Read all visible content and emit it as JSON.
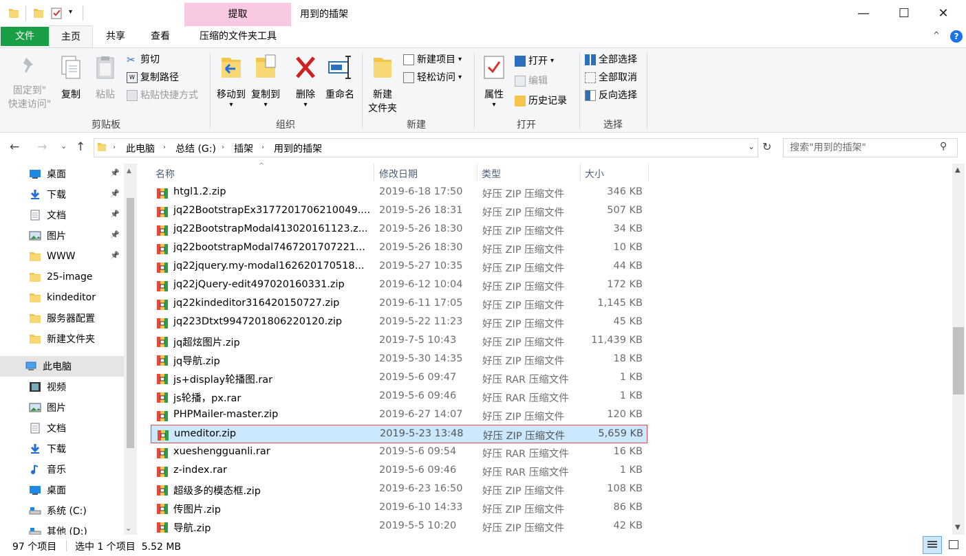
{
  "title_bar": {
    "context_tab": "提取",
    "window_title": "用到的插架",
    "minimize": "—",
    "maximize": "☐",
    "close": "✕"
  },
  "tabs": {
    "file": "文件",
    "home": "主页",
    "share": "共享",
    "view": "查看",
    "compressed_tools": "压缩的文件夹工具"
  },
  "ribbon": {
    "clipboard": {
      "pin": "固定到\"快速访问\"",
      "pin_line1": "固定到\"",
      "pin_line2": "快速访问\"",
      "copy": "复制",
      "paste": "粘贴",
      "cut": "剪切",
      "copy_path": "复制路径",
      "paste_shortcut": "粘贴快捷方式",
      "group": "剪贴板"
    },
    "organize": {
      "move_to": "移动到",
      "copy_to": "复制到",
      "delete": "删除",
      "rename": "重命名",
      "group": "组织"
    },
    "new": {
      "new_folder_line1": "新建",
      "new_folder_line2": "文件夹",
      "new_item": "新建项目",
      "easy_access": "轻松访问",
      "group": "新建"
    },
    "open": {
      "properties": "属性",
      "open": "打开",
      "edit": "编辑",
      "history": "历史记录",
      "group": "打开"
    },
    "select": {
      "select_all": "全部选择",
      "select_none": "全部取消",
      "invert": "反向选择",
      "group": "选择"
    }
  },
  "address": {
    "crumbs": [
      "此电脑",
      "总结 (G:)",
      "插架",
      "用到的插架"
    ],
    "search_placeholder": "搜索\"用到的插架\""
  },
  "nav": {
    "items": [
      {
        "label": "桌面",
        "icon": "desktop-icon",
        "pinned": true
      },
      {
        "label": "下载",
        "icon": "download-icon",
        "pinned": true
      },
      {
        "label": "文档",
        "icon": "document-icon",
        "pinned": true
      },
      {
        "label": "图片",
        "icon": "picture-icon",
        "pinned": true
      },
      {
        "label": "WWW",
        "icon": "folder-icon",
        "pinned": true
      },
      {
        "label": "25-image",
        "icon": "folder-icon",
        "pinned": false
      },
      {
        "label": "kindeditor",
        "icon": "folder-icon",
        "pinned": false
      },
      {
        "label": "服务器配置",
        "icon": "folder-icon",
        "pinned": false
      },
      {
        "label": "新建文件夹",
        "icon": "folder-icon",
        "pinned": false
      },
      {
        "label": "此电脑",
        "icon": "computer-icon",
        "pinned": false
      },
      {
        "label": "视频",
        "icon": "video-icon",
        "pinned": false
      },
      {
        "label": "图片",
        "icon": "picture-icon",
        "pinned": false
      },
      {
        "label": "文档",
        "icon": "document-icon",
        "pinned": false
      },
      {
        "label": "下载",
        "icon": "download-icon",
        "pinned": false
      },
      {
        "label": "音乐",
        "icon": "music-icon",
        "pinned": false
      },
      {
        "label": "桌面",
        "icon": "desktop-icon",
        "pinned": false
      },
      {
        "label": "系统 (C:)",
        "icon": "drive-icon",
        "pinned": false
      },
      {
        "label": "其他 (D:)",
        "icon": "drive-icon",
        "pinned": false
      }
    ]
  },
  "list": {
    "headers": {
      "name": "名称",
      "date": "修改日期",
      "type": "类型",
      "size": "大小"
    },
    "rows": [
      {
        "name": "htgl1.2.zip",
        "date": "2019-6-18 17:50",
        "type": "好压 ZIP 压缩文件",
        "size": "346 KB"
      },
      {
        "name": "jq22BootstrapEx3177201706210049....",
        "date": "2019-5-26 18:31",
        "type": "好压 ZIP 压缩文件",
        "size": "507 KB"
      },
      {
        "name": "jq22BootstrapModal413020161123.z...",
        "date": "2019-5-26 18:30",
        "type": "好压 ZIP 压缩文件",
        "size": "34 KB"
      },
      {
        "name": "jq22bootstrapModal7467201707221...",
        "date": "2019-5-26 18:30",
        "type": "好压 ZIP 压缩文件",
        "size": "10 KB"
      },
      {
        "name": "jq22jquery.my-modal162620170518...",
        "date": "2019-5-27 10:35",
        "type": "好压 ZIP 压缩文件",
        "size": "44 KB"
      },
      {
        "name": "jq22jQuery-edit497020160331.zip",
        "date": "2019-6-12 10:04",
        "type": "好压 ZIP 压缩文件",
        "size": "172 KB"
      },
      {
        "name": "jq22kindeditor316420150727.zip",
        "date": "2019-6-11 17:05",
        "type": "好压 ZIP 压缩文件",
        "size": "1,145 KB"
      },
      {
        "name": "jq223Dtxt9947201806220120.zip",
        "date": "2019-5-22 11:23",
        "type": "好压 ZIP 压缩文件",
        "size": "45 KB"
      },
      {
        "name": "jq超炫图片.zip",
        "date": "2019-7-5 10:43",
        "type": "好压 ZIP 压缩文件",
        "size": "11,439 KB"
      },
      {
        "name": "jq导航.zip",
        "date": "2019-5-30 14:35",
        "type": "好压 ZIP 压缩文件",
        "size": "18 KB"
      },
      {
        "name": "js+display轮播图.rar",
        "date": "2019-5-6 09:47",
        "type": "好压 RAR 压缩文件",
        "size": "1 KB"
      },
      {
        "name": "js轮播，px.rar",
        "date": "2019-5-6 09:46",
        "type": "好压 RAR 压缩文件",
        "size": "1 KB"
      },
      {
        "name": "PHPMailer-master.zip",
        "date": "2019-6-27 14:07",
        "type": "好压 ZIP 压缩文件",
        "size": "120 KB"
      },
      {
        "name": "umeditor.zip",
        "date": "2019-5-23 13:48",
        "type": "好压 ZIP 压缩文件",
        "size": "5,659 KB",
        "selected": true
      },
      {
        "name": "xueshengguanli.rar",
        "date": "2019-5-6 09:54",
        "type": "好压 RAR 压缩文件",
        "size": "16 KB"
      },
      {
        "name": "z-index.rar",
        "date": "2019-5-6 09:46",
        "type": "好压 RAR 压缩文件",
        "size": "1 KB"
      },
      {
        "name": "超级多的模态框.zip",
        "date": "2019-6-23 16:50",
        "type": "好压 ZIP 压缩文件",
        "size": "108 KB"
      },
      {
        "name": "传图片.zip",
        "date": "2019-6-10 14:33",
        "type": "好压 ZIP 压缩文件",
        "size": "86 KB"
      },
      {
        "name": "导航.zip",
        "date": "2019-5-5 10:20",
        "type": "好压 ZIP 压缩文件",
        "size": "42 KB"
      }
    ]
  },
  "status": {
    "count": "97 个项目",
    "selection": "选中 1 个项目  5.52 MB"
  },
  "colors": {
    "file_tab": "#19a047",
    "context_tab": "#f9c9e3",
    "selection": "#cce8ff",
    "selection_border": "#e0474f"
  }
}
